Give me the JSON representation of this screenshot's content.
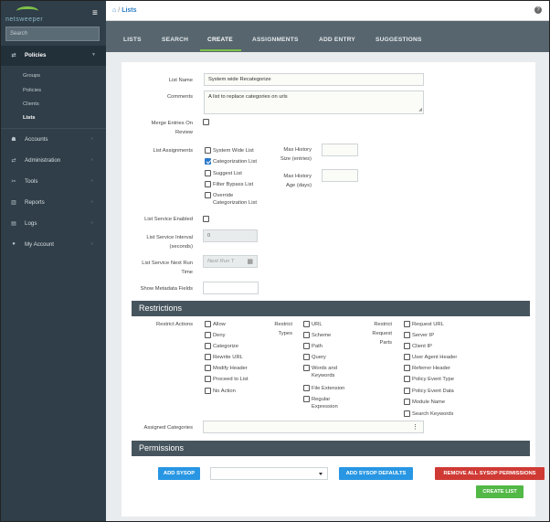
{
  "sidebar": {
    "logo": "netsweeper",
    "search_placeholder": "Search",
    "nav": [
      {
        "icon": "shuffle-icon",
        "glyph": "⇄",
        "label": "Policies"
      },
      {
        "icon": "users-icon",
        "glyph": "👥",
        "label": "Accounts"
      },
      {
        "icon": "shuffle-icon",
        "glyph": "⇄",
        "label": "Administration"
      },
      {
        "icon": "tools-icon",
        "glyph": "✂",
        "label": "Tools"
      },
      {
        "icon": "bar-chart-icon",
        "glyph": "▥",
        "label": "Reports"
      },
      {
        "icon": "file-icon",
        "glyph": "▤",
        "label": "Logs"
      },
      {
        "icon": "user-icon",
        "glyph": "●",
        "label": "My Account"
      }
    ],
    "subitems": [
      "Groups",
      "Policies",
      "Clients",
      "Lists"
    ]
  },
  "breadcrumb": {
    "current": "Lists",
    "separator": "/"
  },
  "tabs": [
    "LISTS",
    "SEARCH",
    "CREATE",
    "ASSIGNMENTS",
    "ADD ENTRY",
    "SUGGESTIONS"
  ],
  "form": {
    "list_name_label": "List Name",
    "list_name_value": "System wide Recategorize",
    "comments_label": "Comments",
    "comments_value": "A list to replace categories on urls",
    "merge_label_1": "Merge Entries On",
    "merge_label_2": "Review",
    "assign_label": "List Assignments",
    "assignments": [
      {
        "label": "System Wide List",
        "checked": false
      },
      {
        "label": "Categorization List",
        "checked": true
      },
      {
        "label": "Suggest List",
        "checked": false
      },
      {
        "label": "Filter Bypass List",
        "checked": false
      },
      {
        "label": "Override",
        "label2": "Categorization List",
        "checked": false
      }
    ],
    "max_size_label_1": "Max History",
    "max_size_label_2": "Size (entries)",
    "max_age_label_1": "Max History",
    "max_age_label_2": "Age (days)",
    "service_enabled_label": "List Service Enabled",
    "interval_label_1": "List Service Interval",
    "interval_label_2": "(seconds)",
    "interval_value": "0",
    "next_run_label_1": "List Service Next Run",
    "next_run_label_2": "Time",
    "next_run_placeholder": "Next Run T",
    "metadata_label": "Show Metadata Fields"
  },
  "restrictions": {
    "title": "Restrictions",
    "actions_label": "Restrict Actions",
    "actions": [
      "Allow",
      "Deny",
      "Categorize",
      "Rewrite URL",
      "Modify Header",
      "Proceed to List",
      "No Action"
    ],
    "types_label_1": "Restrict",
    "types_label_2": "Types",
    "types": [
      "URL",
      "Scheme",
      "Path",
      "Query",
      "Words and",
      "File Extension",
      "Regular"
    ],
    "types_line2": {
      "Words and": "Keywords",
      "Regular": "Expression"
    },
    "parts_label_1": "Restrict",
    "parts_label_2": "Request",
    "parts_label_3": "Parts",
    "parts": [
      "Request URL",
      "Server IP",
      "Client IP",
      "User Agent Header",
      "Referrer Header",
      "Policy Event Type",
      "Policy Event Data",
      "Module Name",
      "Search Keywords"
    ],
    "assigned_categories_label": "Assigned Categories"
  },
  "permissions": {
    "title": "Permissions",
    "add_sysop": "ADD SYSOP",
    "add_defaults": "ADD SYSOP DEFAULTS",
    "remove_all": "REMOVE ALL SYSOP PERMISSIONS",
    "create_list": "CREATE LIST"
  },
  "colors": {
    "sidebar": "#2f3e48",
    "tabbar": "#56656e",
    "accent_green": "#7ec24a",
    "section": "#46545d",
    "blue": "#2896e3",
    "red": "#d03a35",
    "green": "#52b846"
  }
}
